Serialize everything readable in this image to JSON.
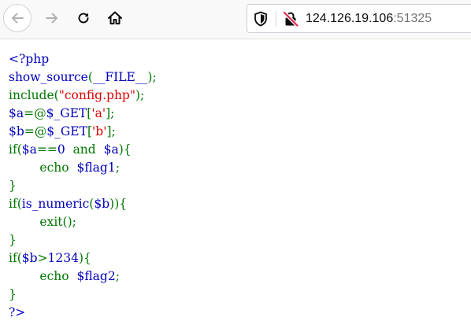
{
  "browser": {
    "url_host": "124.126.19.106",
    "url_port": ":51325",
    "icons": {
      "back": "arrow-left-icon",
      "forward": "arrow-right-icon",
      "reload": "reload-icon",
      "home": "home-icon",
      "tracking": "shield-icon",
      "connection": "insecure-lock-icon"
    }
  },
  "source": {
    "lines": [
      [
        {
          "t": "<?php",
          "c": "d"
        }
      ],
      [
        {
          "t": "show_source",
          "c": "d"
        },
        {
          "t": "(",
          "c": "k"
        },
        {
          "t": "__FILE__",
          "c": "d"
        },
        {
          "t": ");",
          "c": "k"
        }
      ],
      [
        {
          "t": "include(",
          "c": "k"
        },
        {
          "t": "\"config.php\"",
          "c": "s"
        },
        {
          "t": ");",
          "c": "k"
        }
      ],
      [
        {
          "t": "$a",
          "c": "d"
        },
        {
          "t": "=@",
          "c": "k"
        },
        {
          "t": "$_GET",
          "c": "d"
        },
        {
          "t": "[",
          "c": "k"
        },
        {
          "t": "'a'",
          "c": "s"
        },
        {
          "t": "];",
          "c": "k"
        }
      ],
      [
        {
          "t": "$b",
          "c": "d"
        },
        {
          "t": "=@",
          "c": "k"
        },
        {
          "t": "$_GET",
          "c": "d"
        },
        {
          "t": "[",
          "c": "k"
        },
        {
          "t": "'b'",
          "c": "s"
        },
        {
          "t": "];",
          "c": "k"
        }
      ],
      [
        {
          "t": "if(",
          "c": "k"
        },
        {
          "t": "$a",
          "c": "d"
        },
        {
          "t": "==",
          "c": "k"
        },
        {
          "t": "0 ",
          "c": "d"
        },
        {
          "t": " and  ",
          "c": "k"
        },
        {
          "t": "$a",
          "c": "d"
        },
        {
          "t": "){",
          "c": "k"
        }
      ],
      [
        {
          "t": "        echo  ",
          "c": "k"
        },
        {
          "t": "$flag1",
          "c": "d"
        },
        {
          "t": ";",
          "c": "k"
        }
      ],
      [
        {
          "t": "}",
          "c": "k"
        }
      ],
      [
        {
          "t": "if(",
          "c": "k"
        },
        {
          "t": "is_numeric",
          "c": "d"
        },
        {
          "t": "(",
          "c": "k"
        },
        {
          "t": "$b",
          "c": "d"
        },
        {
          "t": ")){",
          "c": "k"
        }
      ],
      [
        {
          "t": "        exit",
          "c": "k"
        },
        {
          "t": "();",
          "c": "k"
        }
      ],
      [
        {
          "t": "}",
          "c": "k"
        }
      ],
      [
        {
          "t": "if(",
          "c": "k"
        },
        {
          "t": "$b",
          "c": "d"
        },
        {
          "t": ">",
          "c": "k"
        },
        {
          "t": "1234",
          "c": "d"
        },
        {
          "t": "){",
          "c": "k"
        }
      ],
      [
        {
          "t": "        echo  ",
          "c": "k"
        },
        {
          "t": "$flag2",
          "c": "d"
        },
        {
          "t": ";",
          "c": "k"
        }
      ],
      [
        {
          "t": "}",
          "c": "k"
        }
      ],
      [
        {
          "t": "?>",
          "c": "d"
        }
      ]
    ]
  },
  "colors": {
    "default": "#0000bb",
    "keyword": "#007700",
    "string": "#dd0000"
  }
}
